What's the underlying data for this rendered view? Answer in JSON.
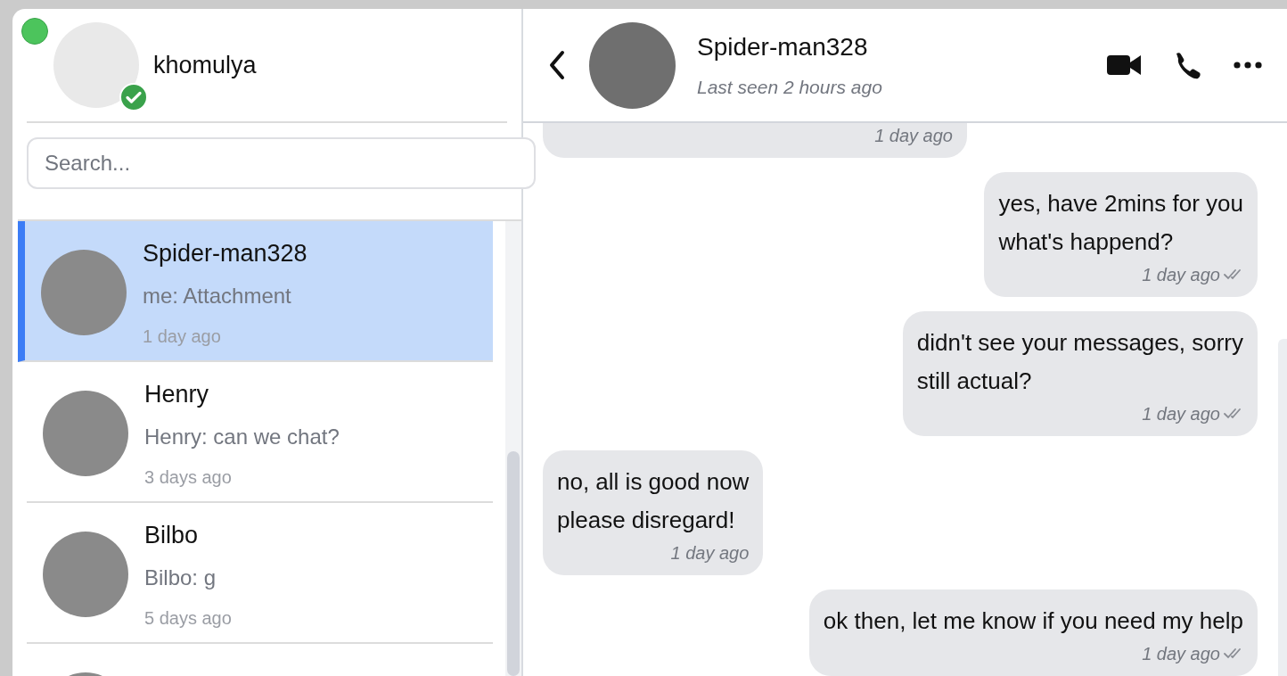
{
  "user": {
    "name": "khomulya",
    "online": true,
    "verified": true
  },
  "search": {
    "placeholder": "Search..."
  },
  "conversations": [
    {
      "name": "Spider-man328",
      "preview": "me: Attachment",
      "time": "1 day ago",
      "selected": true
    },
    {
      "name": "Henry",
      "preview": "Henry: can we chat?",
      "time": "3 days ago",
      "selected": false
    },
    {
      "name": "Bilbo",
      "preview": "Bilbo: g",
      "time": "5 days ago",
      "selected": false
    },
    {
      "selected": false
    }
  ],
  "chat": {
    "contact": {
      "name": "Spider-man328",
      "status": "Last seen 2 hours ago"
    },
    "messages": [
      {
        "outgoing": false,
        "time": "1 day ago",
        "read": false
      },
      {
        "outgoing": true,
        "text": "yes, have 2mins for you\nwhat's happend?",
        "time": "1 day ago",
        "read": true
      },
      {
        "outgoing": true,
        "text": "didn't see your messages, sorry\nstill actual?",
        "time": "1 day ago",
        "read": true
      },
      {
        "outgoing": false,
        "text": "no, all is good now\nplease disregard!",
        "time": "1 day ago",
        "read": false
      },
      {
        "outgoing": true,
        "text": "ok then, let me know if you need my help",
        "time": "1 day ago",
        "read": true
      }
    ]
  }
}
